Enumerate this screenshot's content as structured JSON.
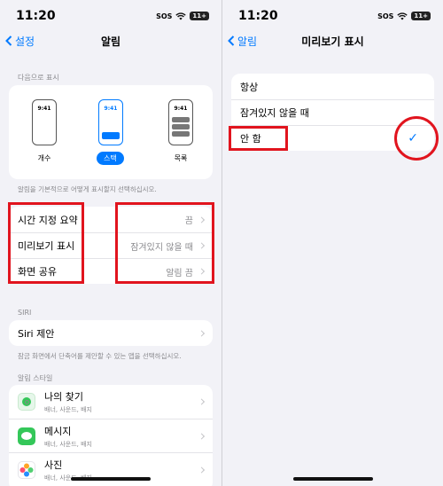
{
  "left": {
    "status": {
      "time": "11:20",
      "sos": "SOS",
      "battery": "11+"
    },
    "nav": {
      "back": "설정",
      "title": "알림"
    },
    "display_as": {
      "header": "다음으로 표시",
      "options": [
        {
          "label": "개수",
          "time": "9:41",
          "selected": false
        },
        {
          "label": "스택",
          "time": "9:41",
          "selected": true
        },
        {
          "label": "목록",
          "time": "9:41",
          "selected": false
        }
      ],
      "footer": "알림을 기본적으로 어떻게 표시할지 선택하십시오."
    },
    "settings_rows": [
      {
        "label": "시간 지정 요약",
        "value": "끔"
      },
      {
        "label": "미리보기 표시",
        "value": "잠겨있지 않을 때"
      },
      {
        "label": "화면 공유",
        "value": "알림 끔"
      }
    ],
    "siri": {
      "header": "SIRI",
      "row": "Siri 제안",
      "footer": "잠금 화면에서 단축어를 제안할 수 있는 앱을 선택하십시오."
    },
    "apps": {
      "header": "알림 스타일",
      "items": [
        {
          "name": "나의 찾기",
          "sub": "배너, 사운드, 배지",
          "icon": "find-my-icon",
          "color": "#34c759"
        },
        {
          "name": "메시지",
          "sub": "배너, 사운드, 배지",
          "icon": "messages-icon",
          "color": "#34c759"
        },
        {
          "name": "사진",
          "sub": "배너, 사운드, 배지",
          "icon": "photos-icon",
          "color": "#ff9500"
        }
      ]
    }
  },
  "right": {
    "status": {
      "time": "11:20",
      "sos": "SOS",
      "battery": "11+"
    },
    "nav": {
      "back": "알림",
      "title": "미리보기 표시"
    },
    "options": [
      {
        "label": "항상",
        "checked": false
      },
      {
        "label": "잠겨있지 않을 때",
        "checked": false
      },
      {
        "label": "안 함",
        "checked": true
      }
    ],
    "check_glyph": "✓"
  },
  "colors": {
    "accent": "#007aff",
    "highlight": "#e1141e",
    "background": "#f2f2f7"
  }
}
